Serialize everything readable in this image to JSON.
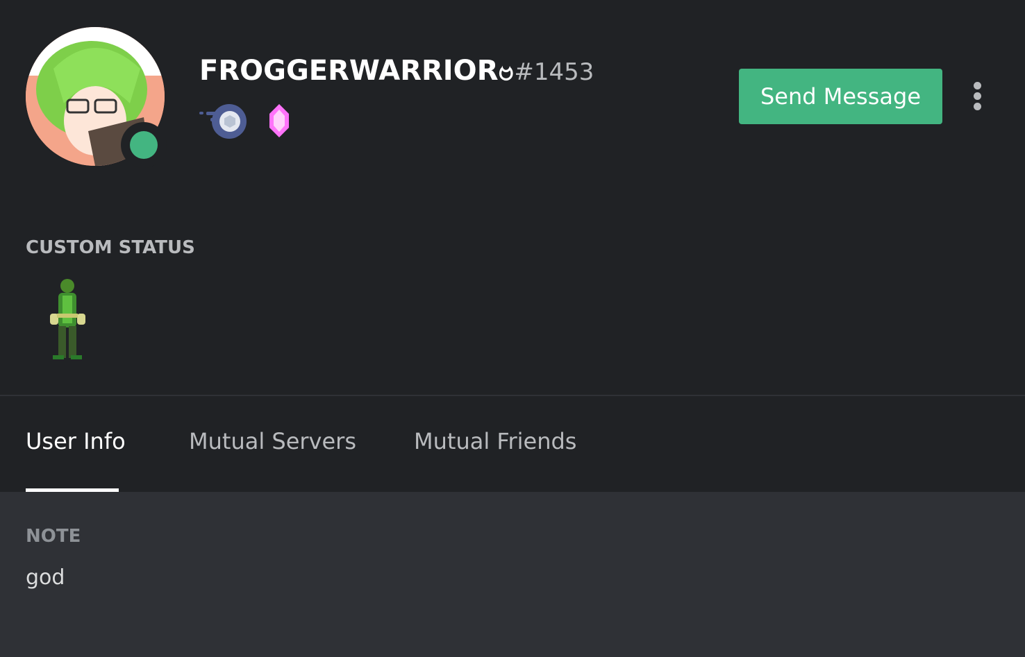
{
  "profile": {
    "username": "FROGGERWARRIORဗ",
    "discriminator": "#1453",
    "status": "online",
    "status_color": "#43b581",
    "badges": [
      "hypesquad-balance-icon",
      "nitro-boost-gem-icon"
    ]
  },
  "actions": {
    "send_message": "Send Message",
    "more": "more-options-icon"
  },
  "custom_status": {
    "label": "CUSTOM STATUS",
    "emoji": "frog-warrior-character-emoji"
  },
  "tabs": [
    {
      "label": "User Info",
      "active": true
    },
    {
      "label": "Mutual Servers",
      "active": false
    },
    {
      "label": "Mutual Friends",
      "active": false
    }
  ],
  "user_info": {
    "note_label": "NOTE",
    "note": "god"
  },
  "colors": {
    "accent": "#43b581",
    "background": "#202225",
    "panel": "#2f3136"
  }
}
